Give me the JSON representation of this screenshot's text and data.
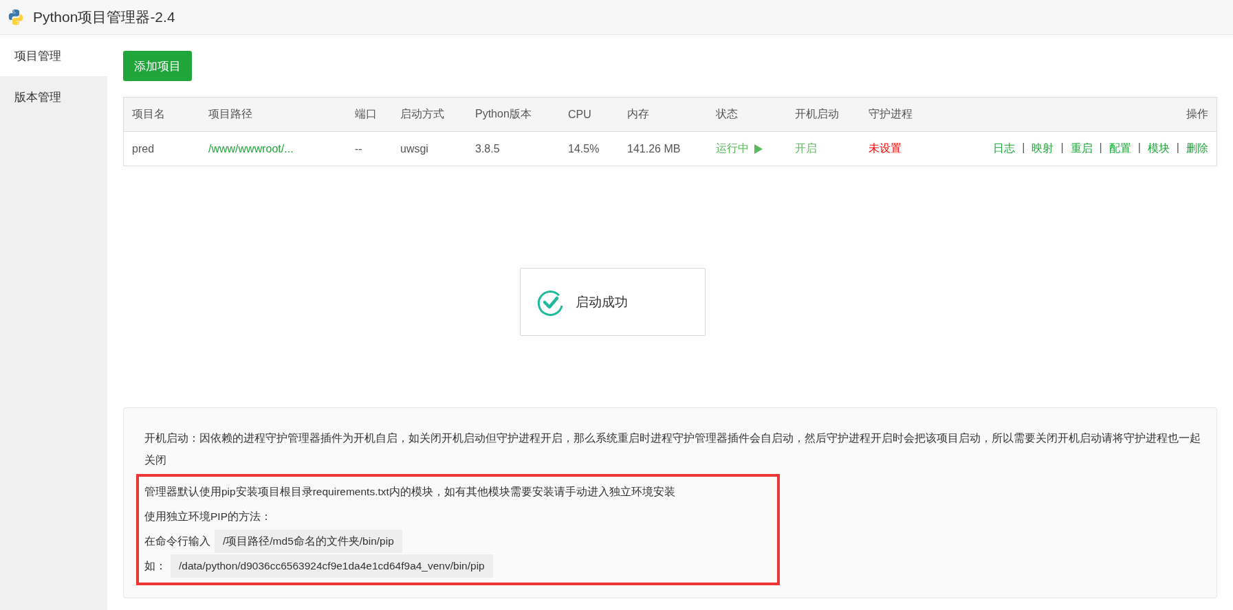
{
  "window": {
    "title": "Python项目管理器-2.4"
  },
  "sidebar": {
    "items": [
      {
        "label": "项目管理",
        "selected": true
      },
      {
        "label": "版本管理",
        "selected": false
      }
    ]
  },
  "add_button": "添加项目",
  "table": {
    "columns": [
      "项目名",
      "项目路径",
      "端口",
      "启动方式",
      "Python版本",
      "CPU",
      "内存",
      "状态",
      "开机启动",
      "守护进程",
      "操作"
    ],
    "rows": [
      {
        "name": "pred",
        "path": "/www/wwwroot/...",
        "port": "--",
        "start_mode": "uwsgi",
        "python_version": "3.8.5",
        "cpu": "14.5%",
        "memory": "141.26 MB",
        "status": {
          "text": "运行中",
          "running": true
        },
        "autostart": {
          "text": "开启",
          "on": true
        },
        "daemon": {
          "text": "未设置",
          "set": false
        },
        "actions": [
          "日志",
          "映射",
          "重启",
          "配置",
          "模块",
          "删除"
        ],
        "separator": "|"
      }
    ]
  },
  "toast": {
    "message": "启动成功"
  },
  "notes": {
    "paragraph": "开机启动：因依赖的进程守护管理器插件为开机自启，如关闭开机启动但守护进程开启，那么系统重启时进程守护管理器插件会自启动，然后守护进程开启时会把该项目启动，所以需要关闭开机启动请将守护进程也一起关闭",
    "highlighted": [
      {
        "text": "管理器默认使用pip安装项目根目录requirements.txt内的模块，如有其他模块需要安装请手动进入独立环境安装"
      },
      {
        "text": "使用独立环境PIP的方法："
      },
      {
        "text": "在命令行输入",
        "code": "/项目路径/md5命名的文件夹/bin/pip"
      },
      {
        "text": "如：",
        "code": "/data/python/d9036cc6563924cf9e1da4e1cd64f9a4_venv/bin/pip"
      }
    ]
  }
}
